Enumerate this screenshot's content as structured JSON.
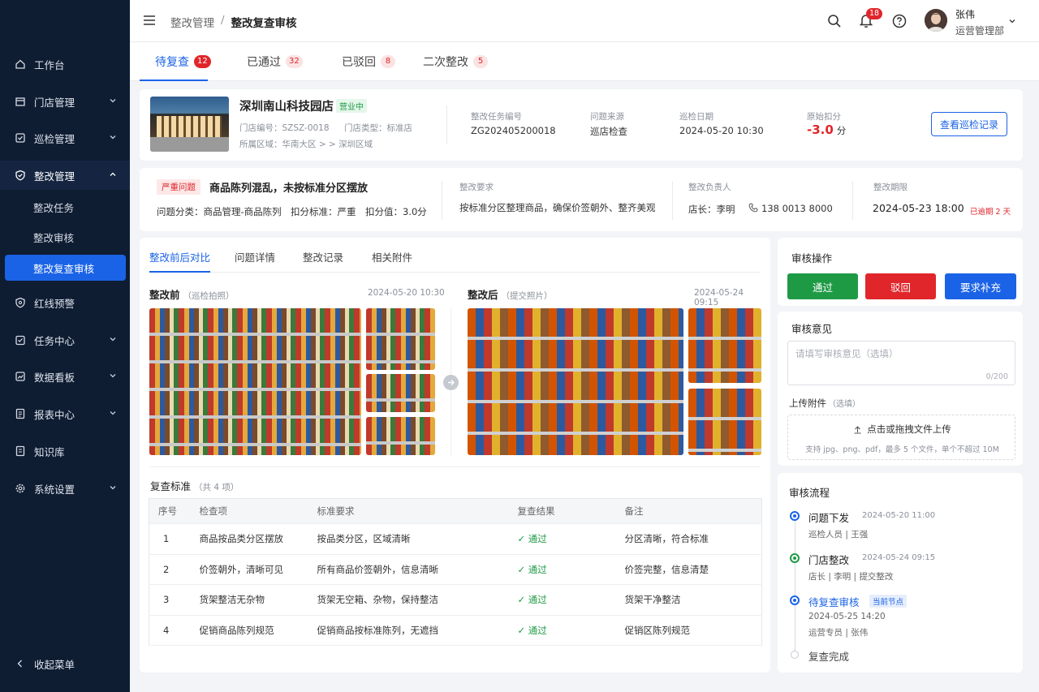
{
  "sidebar": {
    "items": [
      {
        "label": "工作台"
      },
      {
        "label": "门店管理"
      },
      {
        "label": "巡检管理"
      },
      {
        "label": "整改管理"
      },
      {
        "label": "红线预警"
      },
      {
        "label": "任务中心"
      },
      {
        "label": "数据看板"
      },
      {
        "label": "报表中心"
      },
      {
        "label": "知识库"
      },
      {
        "label": "系统设置"
      }
    ],
    "subitems": [
      "整改任务",
      "整改审核",
      "整改复查审核"
    ],
    "collapse": "收起菜单"
  },
  "header": {
    "breadcrumb_parent": "整改管理",
    "breadcrumb_sep": "/",
    "breadcrumb_current": "整改复查审核",
    "notification_count": "18",
    "user_name": "张伟",
    "user_dept": "运营管理部"
  },
  "tabs": [
    {
      "label": "待复查",
      "count": "12"
    },
    {
      "label": "已通过",
      "count": "32"
    },
    {
      "label": "已驳回",
      "count": "8"
    },
    {
      "label": "二次整改",
      "count": "5"
    }
  ],
  "store": {
    "name": "深圳南山科技园店",
    "status": "营业中",
    "code_label": "门店编号：",
    "code": "SZSZ-0018",
    "type_label": "门店类型：",
    "type": "标准店",
    "region_label": "所属区域：",
    "region": "华南大区 > > 深圳区域",
    "task_no_label": "整改任务编号",
    "task_no": "ZG202405200018",
    "source_label": "问题来源",
    "source": "巡店检查",
    "date_label": "巡检日期",
    "date": "2024-05-20 10:30",
    "deduct_label": "原始扣分",
    "deduct": "-3.0",
    "deduct_unit": "分",
    "view_button": "查看巡检记录"
  },
  "issue": {
    "level": "严重问题",
    "title": "商品陈列混乱，未按标准分区摆放",
    "category": "问题分类：商品管理-商品陈列",
    "standard": "扣分标准：严重",
    "score": "扣分值：3.0分",
    "req_label": "整改要求",
    "req": "按标准分区整理商品，确保价签朝外、整齐美观",
    "owner_label": "整改负责人",
    "owner": "店长：李明",
    "phone": "138 0013 8000",
    "deadline_label": "整改期限",
    "deadline": "2024-05-23 18:00",
    "overdue": "已逾期 2 天"
  },
  "compare": {
    "tabs": [
      "整改前后对比",
      "问题详情",
      "整改记录",
      "相关附件"
    ],
    "before_title": "整改前",
    "before_note": "（巡检拍照）",
    "before_time": "2024-05-20 10:30",
    "after_title": "整改后",
    "after_note": "（提交照片）",
    "after_time": "2024-05-24 09:15"
  },
  "criteria": {
    "title": "复查标准",
    "count": "（共 4 项）",
    "headers": [
      "序号",
      "检查项",
      "标准要求",
      "复查结果",
      "备注"
    ],
    "rows": [
      {
        "no": "1",
        "item": "商品按品类分区摆放",
        "req": "按品类分区，区域清晰",
        "result": "通过",
        "note": "分区清晰，符合标准"
      },
      {
        "no": "2",
        "item": "价签朝外，清晰可见",
        "req": "所有商品价签朝外，信息清晰",
        "result": "通过",
        "note": "价签完整，信息清楚"
      },
      {
        "no": "3",
        "item": "货架整洁无杂物",
        "req": "货架无空箱、杂物，保持整洁",
        "result": "通过",
        "note": "货架干净整洁"
      },
      {
        "no": "4",
        "item": "促销商品陈列规范",
        "req": "促销商品按标准陈列，无遮挡",
        "result": "通过",
        "note": "促销区陈列规范"
      }
    ]
  },
  "review": {
    "title": "审核操作",
    "approve": "通过",
    "reject": "驳回",
    "supplement": "要求补充",
    "opinion_title": "审核意见",
    "opinion_placeholder": "请填写审核意见（选填）",
    "opinion_count": "0/200",
    "upload_title": "上传附件",
    "upload_optional": "（选填）",
    "upload_text": "点击或拖拽文件上传",
    "upload_hint": "支持 jpg、png、pdf，最多 5 个文件，单个不超过 10M"
  },
  "flow": {
    "title": "审核流程",
    "steps": [
      {
        "name": "问题下发",
        "time": "2024-05-20 11:00",
        "role": "巡检人员",
        "person": "王强"
      },
      {
        "name": "门店整改",
        "time": "2024-05-24 09:15",
        "role": "店长",
        "person": "李明",
        "extra": "提交整改"
      },
      {
        "name": "待复查审核",
        "tag": "当前节点",
        "time": "2024-05-25 14:20",
        "role": "运营专员",
        "person": "张伟"
      },
      {
        "name": "复查完成"
      }
    ]
  },
  "colors": {
    "primary": "#1b63e6",
    "success": "#1e9a45",
    "danger": "#e0262b",
    "sidebar": "#0f1d33"
  }
}
